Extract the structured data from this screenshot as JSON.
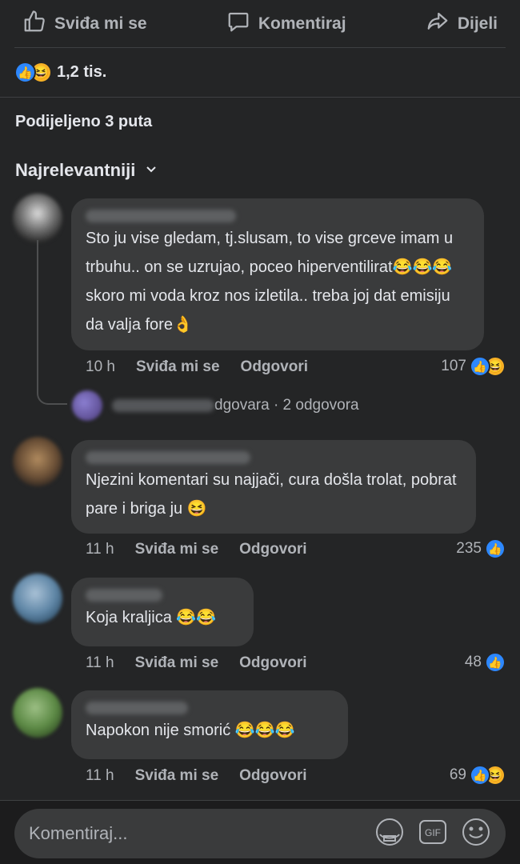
{
  "actions": {
    "like_label": "Sviđa mi se",
    "comment_label": "Komentiraj",
    "share_label": "Dijeli"
  },
  "post": {
    "reaction_count": "1,2 tis.",
    "shares": "Podijeljeno 3 puta",
    "sort_label": "Najrelevantniji"
  },
  "comments": [
    {
      "text": "Sto ju vise gledam, tj.slusam, to vise grceve imam u trbuhu.. on se uzrujao, poceo hiperventilirat😂😂😂 skoro mi voda kroz nos izletila.. treba joj dat emisiju da valja fore👌",
      "time": "10 h",
      "like": "Sviđa mi se",
      "reply": "Odgovori",
      "reactions": "107",
      "reply_summary": "dgovara · 2 odgovora"
    },
    {
      "text": "Njezini komentari su najjači, cura došla trolat, pobrat pare i briga ju 😆",
      "time": "11 h",
      "like": "Sviđa mi se",
      "reply": "Odgovori",
      "reactions": "235"
    },
    {
      "text": "Koja kraljica 😂😂",
      "time": "11 h",
      "like": "Sviđa mi se",
      "reply": "Odgovori",
      "reactions": "48"
    },
    {
      "text": "Napokon nije smorić 😂😂😂",
      "time": "11 h",
      "like": "Sviđa mi se",
      "reply": "Odgovori",
      "reactions": "69"
    }
  ],
  "composer": {
    "placeholder": "Komentiraj..."
  },
  "colors": {
    "background": "#242526",
    "bubble": "#3a3b3c",
    "like_blue": "#2d88ff",
    "haha_yellow": "#f7b125"
  }
}
